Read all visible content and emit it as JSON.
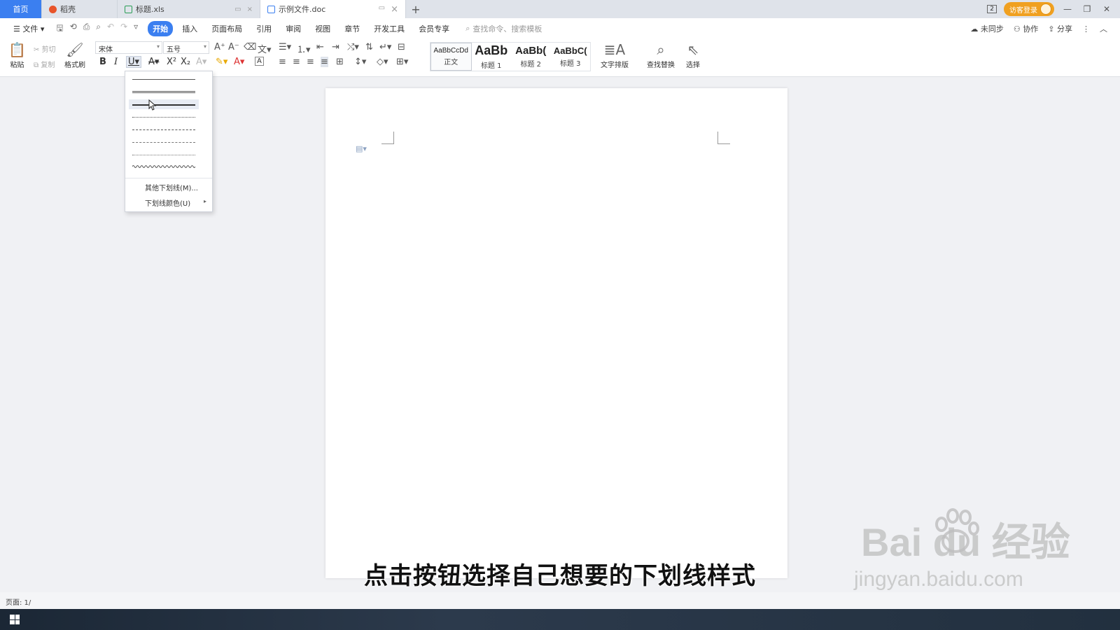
{
  "tabs": {
    "home": "首页",
    "daoke": "稻壳",
    "xls": "标题.xls",
    "doc": "示例文件.doc",
    "new": "+"
  },
  "titlebar": {
    "badge": "2",
    "login": "访客登录"
  },
  "menu": {
    "file": "文件",
    "items": [
      "开始",
      "插入",
      "页面布局",
      "引用",
      "审阅",
      "视图",
      "章节",
      "开发工具",
      "会员专享"
    ],
    "active_index": 0,
    "search": "查找命令、搜索模板",
    "right": [
      "未同步",
      "协作",
      "分享"
    ]
  },
  "ribbon": {
    "paste": "粘贴",
    "cut": "剪切",
    "copy": "复制",
    "format_painter": "格式刷",
    "font_name": "宋体",
    "font_size": "五号",
    "styles": [
      {
        "preview": "AaBbCcDd",
        "label": "正文"
      },
      {
        "preview": "AaBb",
        "label": "标题 1"
      },
      {
        "preview": "AaBb(",
        "label": "标题 2"
      },
      {
        "preview": "AaBbC(",
        "label": "标题 3"
      }
    ],
    "text_layout": "文字排版",
    "find_replace": "查找替换",
    "select": "选择"
  },
  "underline_menu": {
    "styles": [
      "single",
      "double",
      "thick",
      "dotted",
      "dashed",
      "dash-dot",
      "dash-dot-dot",
      "wavy"
    ],
    "hovered_index": 2,
    "more": "其他下划线(M)...",
    "color": "下划线颜色(U)"
  },
  "status": {
    "page": "页面: 1/"
  },
  "subtitle": "点击按钮选择自己想要的下划线样式",
  "watermark": {
    "brand": "Bai du 经验",
    "url": "jingyan.baidu.com"
  },
  "colors": {
    "accent": "#3b7ff0",
    "login": "#f0a020"
  }
}
